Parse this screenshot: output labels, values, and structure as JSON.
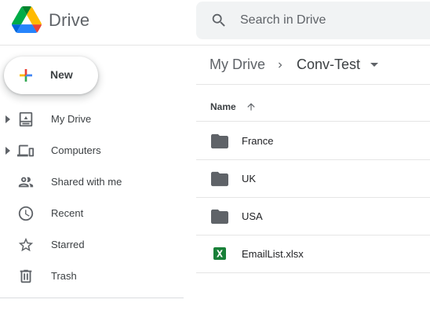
{
  "header": {
    "brand": "Drive",
    "search_placeholder": "Search in Drive"
  },
  "sidebar": {
    "new_label": "New",
    "items": [
      {
        "label": "My Drive",
        "icon": "my-drive-icon",
        "expandable": true
      },
      {
        "label": "Computers",
        "icon": "computers-icon",
        "expandable": true
      },
      {
        "label": "Shared with me",
        "icon": "shared-icon",
        "expandable": false
      },
      {
        "label": "Recent",
        "icon": "clock-icon",
        "expandable": false
      },
      {
        "label": "Starred",
        "icon": "star-icon",
        "expandable": false
      },
      {
        "label": "Trash",
        "icon": "trash-icon",
        "expandable": false
      }
    ]
  },
  "breadcrumb": {
    "root": "My Drive",
    "current": "Conv-Test"
  },
  "file_list": {
    "column_name": "Name",
    "sort": "ascending",
    "files": [
      {
        "name": "France",
        "type": "folder"
      },
      {
        "name": "UK",
        "type": "folder"
      },
      {
        "name": "USA",
        "type": "folder"
      },
      {
        "name": "EmailList.xlsx",
        "type": "spreadsheet"
      }
    ]
  },
  "colors": {
    "accent_blue": "#4285f4",
    "accent_red": "#ea4335",
    "accent_yellow": "#fbbc04",
    "accent_green": "#34a853",
    "icon_gray": "#5f6368",
    "sheets_green": "#188038"
  }
}
